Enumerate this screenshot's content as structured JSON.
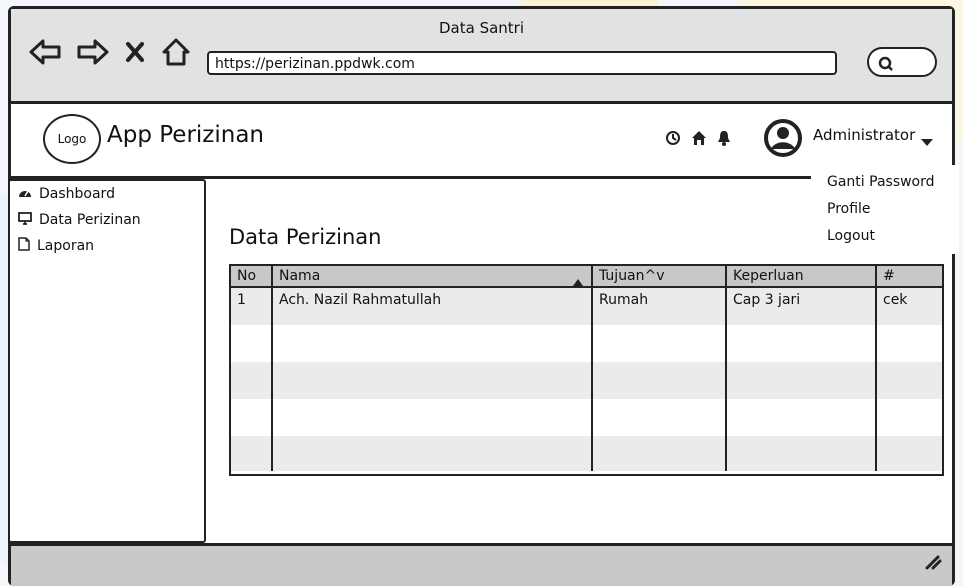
{
  "browser": {
    "window_title": "Data Santri",
    "url": "https://perizinan.ppdwk.com"
  },
  "header": {
    "logo_text": "Logo",
    "app_title": "App Perizinan",
    "user_name": "Administrator"
  },
  "user_menu": {
    "items": [
      {
        "label": "Ganti Password"
      },
      {
        "label": "Profile"
      },
      {
        "label": "Logout"
      }
    ]
  },
  "sidebar": {
    "items": [
      {
        "label": "Dashboard",
        "icon": "dashboard-icon"
      },
      {
        "label": "Data Perizinan",
        "icon": "monitor-icon"
      },
      {
        "label": "Laporan",
        "icon": "document-icon"
      }
    ]
  },
  "main": {
    "title": "Data Perizinan",
    "table": {
      "headers": [
        "No",
        "Nama",
        "Tujuan^v",
        "Keperluan",
        "#"
      ],
      "rows": [
        {
          "no": "1",
          "nama": "Ach. Nazil Rahmatullah",
          "tujuan": "Rumah",
          "keperluan": "Cap 3 jari",
          "aksi": "cek"
        }
      ]
    }
  }
}
